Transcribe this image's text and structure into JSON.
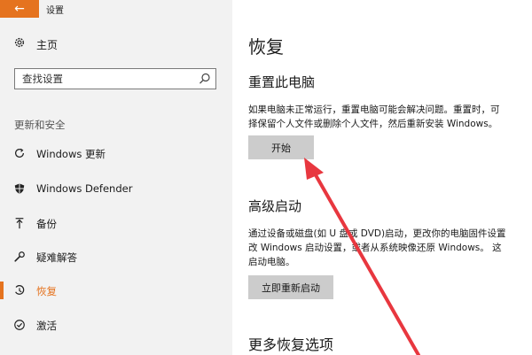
{
  "window": {
    "title": "设置",
    "back_icon": "←"
  },
  "sidebar": {
    "home_label": "主页",
    "search_placeholder": "查找设置",
    "section_label": "更新和安全",
    "items": [
      {
        "label": "Windows 更新",
        "icon": "refresh-icon"
      },
      {
        "label": "Windows Defender",
        "icon": "shield-icon"
      },
      {
        "label": "备份",
        "icon": "upload-arrow-icon"
      },
      {
        "label": "疑难解答",
        "icon": "wrench-icon"
      },
      {
        "label": "恢复",
        "icon": "history-icon",
        "active": true
      },
      {
        "label": "激活",
        "icon": "check-circle-icon"
      }
    ]
  },
  "main": {
    "title": "恢复",
    "reset": {
      "title": "重置此电脑",
      "desc_line1": "如果电脑未正常运行，重置电脑可能会解决问题。重置时，可",
      "desc_line2": "择保留个人文件或删除个人文件，然后重新安装 Windows。",
      "button": "开始"
    },
    "advanced": {
      "title": "高级启动",
      "desc_line1": "通过设备或磁盘(如 U 盘或 DVD)启动，更改你的电脑固件设置",
      "desc_line2": "改 Windows 启动设置，或者从系统映像还原 Windows。 这",
      "desc_line3": "启动电脑。",
      "button": "立即重新启动"
    },
    "more_title": "更多恢复选项"
  },
  "colors": {
    "accent": "#e5731f",
    "annotation_arrow": "#e8373f",
    "sidebar_bg": "#f2f2f2",
    "button_bg": "#cccccc"
  }
}
